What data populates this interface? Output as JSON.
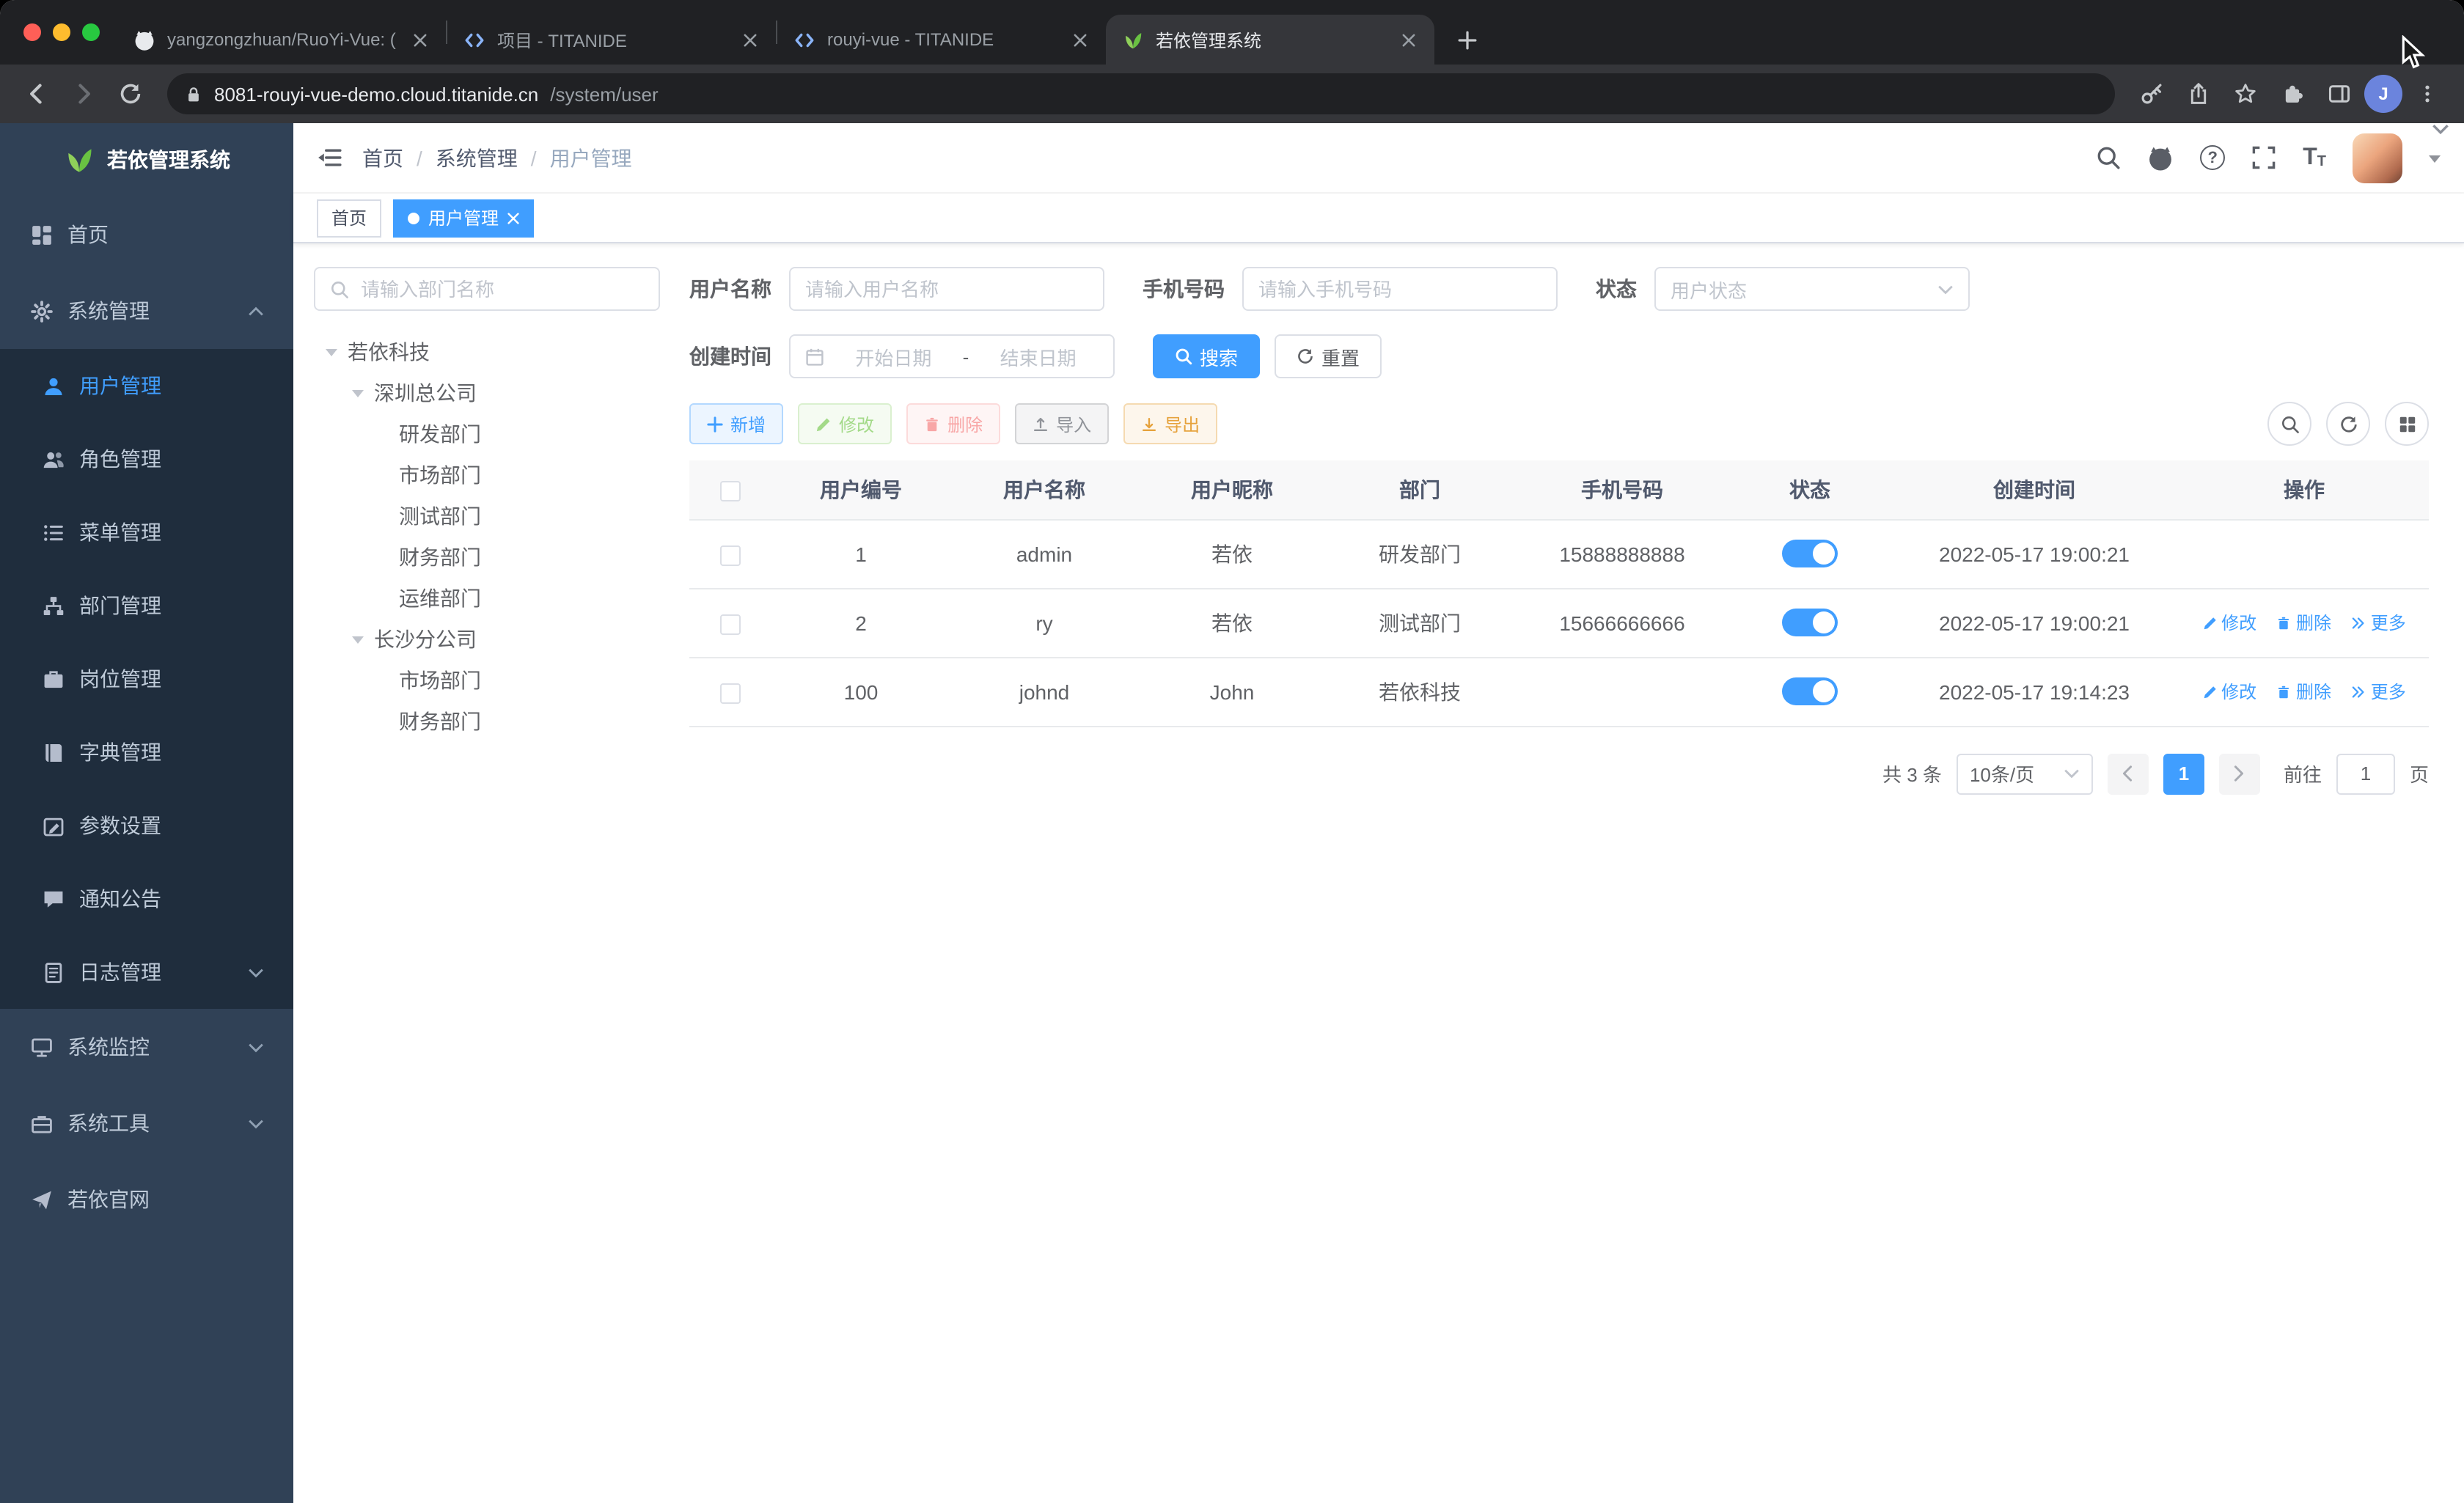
{
  "colors": {
    "primary": "#409eff",
    "success": "#67c23a",
    "danger": "#f56c6c",
    "warning": "#e6a23c",
    "info": "#909399",
    "sidebar_bg": "#304156",
    "sidebar_submenu_bg": "#1f2d3d",
    "chrome_dark": "#202124",
    "chrome_toolbar": "#35363a"
  },
  "glyphs": {
    "help": "?",
    "text_size": "T"
  },
  "browser": {
    "tabs": [
      {
        "title": "yangzongzhuan/RuoYi-Vue: (R",
        "icon": "github-icon"
      },
      {
        "title": "项目 - TITANIDE",
        "icon": "code-icon"
      },
      {
        "title": "rouyi-vue - TITANIDE",
        "icon": "code-icon"
      },
      {
        "title": "若依管理系统",
        "icon": "leaf-icon"
      }
    ],
    "url_host": "8081-rouyi-vue-demo.cloud.titanide.cn",
    "url_path": "/system/user",
    "profile_initial": "J"
  },
  "sidebar": {
    "logo_text": "若依管理系统",
    "home": "首页",
    "system": "系统管理",
    "sub": {
      "user": "用户管理",
      "role": "角色管理",
      "menu": "菜单管理",
      "dept": "部门管理",
      "post": "岗位管理",
      "dict": "字典管理",
      "param": "参数设置",
      "notice": "通知公告",
      "log": "日志管理"
    },
    "monitor": "系统监控",
    "tools": "系统工具",
    "site": "若依官网"
  },
  "navbar": {
    "breadcrumb": [
      "首页",
      "系统管理",
      "用户管理"
    ],
    "separator": "/"
  },
  "tags": {
    "home": "首页",
    "active": "用户管理"
  },
  "dept_tree": {
    "search_placeholder": "请输入部门名称",
    "root": "若依科技",
    "branch1": "深圳总公司",
    "branch1_children": [
      "研发部门",
      "市场部门",
      "测试部门",
      "财务部门",
      "运维部门"
    ],
    "branch2": "长沙分公司",
    "branch2_children": [
      "市场部门",
      "财务部门"
    ]
  },
  "filters": {
    "username_label": "用户名称",
    "username_placeholder": "请输入用户名称",
    "phone_label": "手机号码",
    "phone_placeholder": "请输入手机号码",
    "status_label": "状态",
    "status_placeholder": "用户状态",
    "created_label": "创建时间",
    "date_start": "开始日期",
    "date_separator": "-",
    "date_end": "结束日期",
    "search": "搜索",
    "reset": "重置"
  },
  "actions": {
    "add": "新增",
    "edit": "修改",
    "delete": "删除",
    "import": "导入",
    "export": "导出"
  },
  "table": {
    "headers": [
      "用户编号",
      "用户名称",
      "用户昵称",
      "部门",
      "手机号码",
      "状态",
      "创建时间",
      "操作"
    ],
    "rows": [
      {
        "id": "1",
        "username": "admin",
        "nickname": "若依",
        "dept": "研发部门",
        "phone": "15888888888",
        "created": "2022-05-17 19:00:21"
      },
      {
        "id": "2",
        "username": "ry",
        "nickname": "若依",
        "dept": "测试部门",
        "phone": "15666666666",
        "created": "2022-05-17 19:00:21"
      },
      {
        "id": "100",
        "username": "johnd",
        "nickname": "John",
        "dept": "若依科技",
        "phone": "",
        "created": "2022-05-17 19:14:23"
      }
    ],
    "op_edit": "修改",
    "op_delete": "删除",
    "op_more": "更多"
  },
  "pagination": {
    "total": "共 3 条",
    "page_size": "10条/页",
    "page": "1",
    "goto": "前往",
    "unit": "页"
  }
}
